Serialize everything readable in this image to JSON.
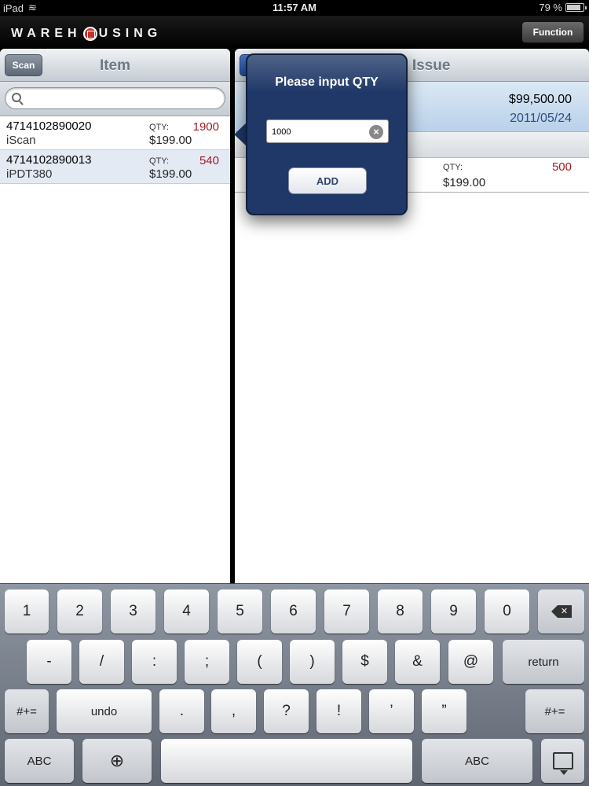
{
  "statusbar": {
    "device": "iPad",
    "time": "11:57 AM",
    "battery": "79 %",
    "battery_level": 0.79
  },
  "header": {
    "logo": "WAREH",
    "logo_tail": "USING",
    "function_label": "Function"
  },
  "left": {
    "title": "Item",
    "scan_label": "Scan",
    "search_placeholder": "",
    "items": [
      {
        "code": "4714102890020",
        "name": "iScan",
        "qty_label": "QTY:",
        "qty": "1900",
        "price": "$199.00"
      },
      {
        "code": "4714102890013",
        "name": "iPDT380",
        "qty_label": "QTY:",
        "qty": "540",
        "price": "$199.00"
      }
    ]
  },
  "right": {
    "title": "s Issue",
    "amount": "$99,500.00",
    "date": "2011/05/24",
    "rows": [
      {
        "qty_label": "QTY:",
        "qty": "500",
        "price": "$199.00"
      }
    ]
  },
  "popover": {
    "title": "Please input QTY",
    "qty_value": "1000",
    "clear_symbol": "×",
    "add_label": "ADD"
  },
  "keyboard": {
    "row1": [
      "1",
      "2",
      "3",
      "4",
      "5",
      "6",
      "7",
      "8",
      "9",
      "0"
    ],
    "row2": [
      "-",
      "/",
      ":",
      ";",
      "(",
      ")",
      "$",
      "&",
      "@"
    ],
    "return_label": "return",
    "row3": [
      ".",
      ",",
      "?",
      "!",
      "’",
      "”"
    ],
    "alt_label": "#+=",
    "undo_label": "undo",
    "abc_label": "ABC"
  },
  "colors": {
    "accent_red": "#a01c28",
    "popover_bg": "#1f3868",
    "date_blue": "#2a4f86"
  }
}
